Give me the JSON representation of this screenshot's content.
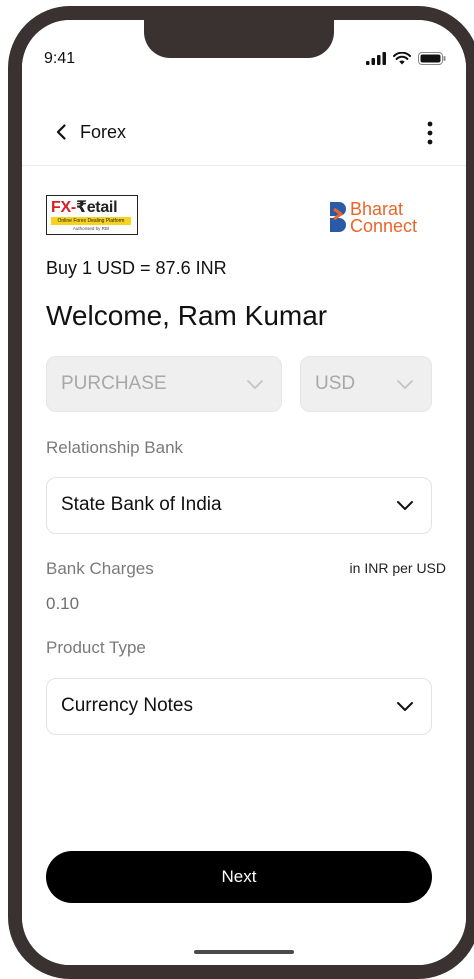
{
  "status_bar": {
    "time": "9:41"
  },
  "header": {
    "title": "Forex"
  },
  "logos": {
    "fx_retail": {
      "main_red": "FX-",
      "main_dark": "₹etail",
      "tagline": "Online Forex Dealing Platform",
      "authorized": "Authorised by RBI"
    },
    "bharat_connect": {
      "line1": "Bharat",
      "line2": "Connect"
    }
  },
  "rate_text": "Buy 1 USD = 87.6 INR",
  "welcome_text": "Welcome, Ram Kumar",
  "transaction_type": {
    "value": "PURCHASE"
  },
  "currency": {
    "value": "USD"
  },
  "relationship_bank": {
    "label": "Relationship Bank",
    "value": "State Bank of India"
  },
  "bank_charges": {
    "label": "Bank Charges",
    "unit": "in INR per USD",
    "value": "0.10"
  },
  "product_type": {
    "label": "Product Type",
    "value": "Currency Notes"
  },
  "next_button": {
    "label": "Next"
  },
  "colors": {
    "brand_orange": "#e8662a",
    "brand_blue": "#2a5aa8",
    "fx_red": "#d81f26",
    "fx_yellow": "#f6d31e",
    "frame": "#3a3131",
    "button_bg": "#000000"
  }
}
